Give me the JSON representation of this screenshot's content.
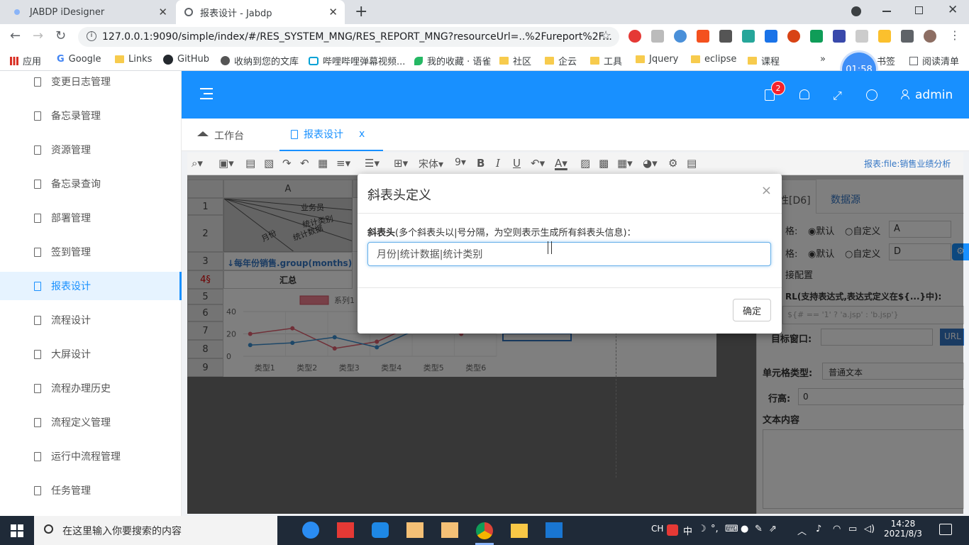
{
  "browser": {
    "tabs": [
      {
        "title": "JABDP iDesigner",
        "close": "✕"
      },
      {
        "title": "报表设计 - Jabdp",
        "close": "✕"
      }
    ],
    "new_tab": "+",
    "url": "127.0.0.1:9090/simple/index/#/RES_SYSTEM_MNG/RES_REPORT_MNG?resourceUrl=..%2Fureport%2F...",
    "bookmarks": [
      "应用",
      "Google",
      "Links",
      "GitHub",
      "收纳到您的文库",
      "哔哩哔哩弹幕视频...",
      "我的收藏 · 语雀",
      "社区",
      "企云",
      "工具",
      "Jquery",
      "eclipse",
      "课程",
      "书签",
      "阅读清单"
    ],
    "more": "»"
  },
  "timer": "01:58",
  "sidebar": {
    "items": [
      {
        "label": "变更日志管理"
      },
      {
        "label": "备忘录管理"
      },
      {
        "label": "资源管理"
      },
      {
        "label": "备忘录查询"
      },
      {
        "label": "部署管理"
      },
      {
        "label": "签到管理"
      },
      {
        "label": "报表设计"
      },
      {
        "label": "流程设计"
      },
      {
        "label": "大屏设计"
      },
      {
        "label": "流程办理历史"
      },
      {
        "label": "流程定义管理"
      },
      {
        "label": "运行中流程管理"
      },
      {
        "label": "任务管理"
      }
    ]
  },
  "header": {
    "badge": "2",
    "user": "admin"
  },
  "page_tabs": [
    {
      "label": "工作台"
    },
    {
      "label": "报表设计",
      "close": "x"
    }
  ],
  "editor": {
    "font_name": "宋体",
    "font_size": "9",
    "report_label": "报表:file:销售业绩分析",
    "col_a": "A",
    "rows": [
      "1",
      "2",
      "3",
      "4",
      "5",
      "6",
      "7",
      "8",
      "9"
    ],
    "row4_label": "4§",
    "diag_texts": [
      "业务员",
      "统计类别",
      "统计数据",
      "月份"
    ],
    "row3_text": "↓每年份销售.group(months)",
    "row4_text": "汇总",
    "chart_legend": "系列1",
    "chart_y": [
      "40",
      "20",
      "0"
    ],
    "chart_x": [
      "类型1",
      "类型2",
      "类型3",
      "类型4",
      "类型5",
      "类型6"
    ]
  },
  "right_panel": {
    "tab1": "性[D6]",
    "tab2": "数据源",
    "row1_label": "格:",
    "row2_label": "格:",
    "opt_default": "默认",
    "opt_custom": "自定义",
    "sel1": "A",
    "sel2": "D",
    "link_config": "接配置",
    "url_label": "RL(支持表达式,表达式定义在${...}中):",
    "url_placeholder": "${# == '1' ? 'a.jsp' : 'b.jsp'}",
    "target_label": "目标窗口:",
    "url_btn": "URL",
    "cell_type_label": "单元格类型:",
    "cell_type_value": "普通文本",
    "row_height_label": "行高:",
    "row_height_value": "0",
    "text_label": "文本内容"
  },
  "modal": {
    "title": "斜表头定义",
    "close": "×",
    "label_bold": "斜表头",
    "label_hint": "(多个斜表头以|号分隔，为空则表示生成所有斜表头信息)：",
    "input_value": "月份|统计数据|统计类别",
    "ok": "确定"
  },
  "taskbar": {
    "search_placeholder": "在这里输入你要搜索的内容",
    "ime1": "CH",
    "ime2": "中",
    "time": "14:28",
    "date": "2021/8/3"
  }
}
